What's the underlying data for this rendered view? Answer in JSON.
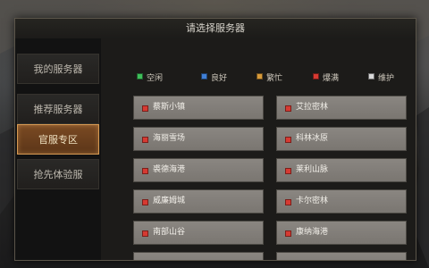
{
  "dialog": {
    "title": "请选择服务器"
  },
  "sidebar": {
    "items": [
      {
        "label": "我的服务器",
        "active": false
      },
      {
        "label": "推荐服务器",
        "active": false
      },
      {
        "label": "官服专区",
        "active": true
      },
      {
        "label": "抢先体验服",
        "active": false
      }
    ]
  },
  "legend": [
    {
      "label": "空闲",
      "color": "#3fbf5a",
      "icon": "status-dot"
    },
    {
      "label": "良好",
      "color": "#3f7fd6",
      "icon": "status-dot"
    },
    {
      "label": "繁忙",
      "color": "#d79a3a",
      "icon": "status-dot"
    },
    {
      "label": "爆满",
      "color": "#d63a32",
      "icon": "status-dot"
    },
    {
      "label": "维护",
      "color": "#d8d8d8",
      "icon": "status-dot"
    }
  ],
  "servers": [
    {
      "name": "蔡斯小镇",
      "status_color": "#d63a32"
    },
    {
      "name": "艾拉密林",
      "status_color": "#d63a32"
    },
    {
      "name": "海丽雪场",
      "status_color": "#d63a32"
    },
    {
      "name": "科林冰原",
      "status_color": "#d63a32"
    },
    {
      "name": "裘德海港",
      "status_color": "#d63a32"
    },
    {
      "name": "莱利山脉",
      "status_color": "#d63a32"
    },
    {
      "name": "威廉姆城",
      "status_color": "#d63a32"
    },
    {
      "name": "卡尔密林",
      "status_color": "#d63a32"
    },
    {
      "name": "南部山谷",
      "status_color": "#d63a32"
    },
    {
      "name": "康纳海港",
      "status_color": "#d63a32"
    }
  ]
}
